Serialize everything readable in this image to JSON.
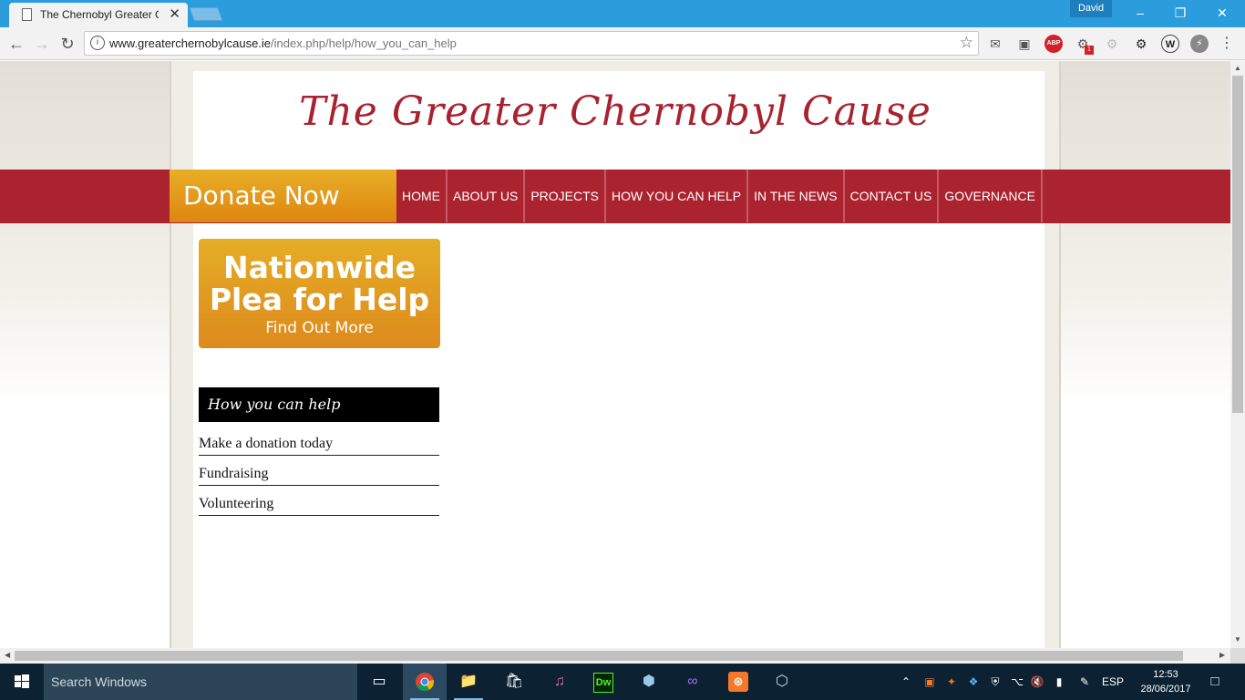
{
  "browser": {
    "tab_title": "The Chernobyl Greater C",
    "tab_close": "✕",
    "profile_name": "David",
    "url_host": "www.greaterchernobylcause.ie",
    "url_path": "/index.php/help/how_you_can_help",
    "extension_badge": "1",
    "abp_label": "ABP"
  },
  "site": {
    "title": "The Greater Chernobyl Cause",
    "donate_label": "Donate Now",
    "menu": [
      "HOME",
      "ABOUT US",
      "PROJECTS",
      "HOW YOU CAN HELP",
      "IN THE NEWS",
      "CONTACT US",
      "GOVERNANCE"
    ],
    "plea": {
      "line1": "Nationwide",
      "line2": "Plea for Help",
      "cta": "Find Out More"
    },
    "sidebar": {
      "heading": "How you can help",
      "links": [
        "Make a donation today",
        "Fundraising",
        "Volunteering"
      ]
    }
  },
  "taskbar": {
    "search_placeholder": "Search Windows",
    "language": "ESP",
    "time": "12:53",
    "date": "28/06/2017"
  },
  "colors": {
    "brand_red": "#ab232f",
    "donate_orange": "#e8ae26",
    "chrome_blue": "#2b9cdc"
  }
}
